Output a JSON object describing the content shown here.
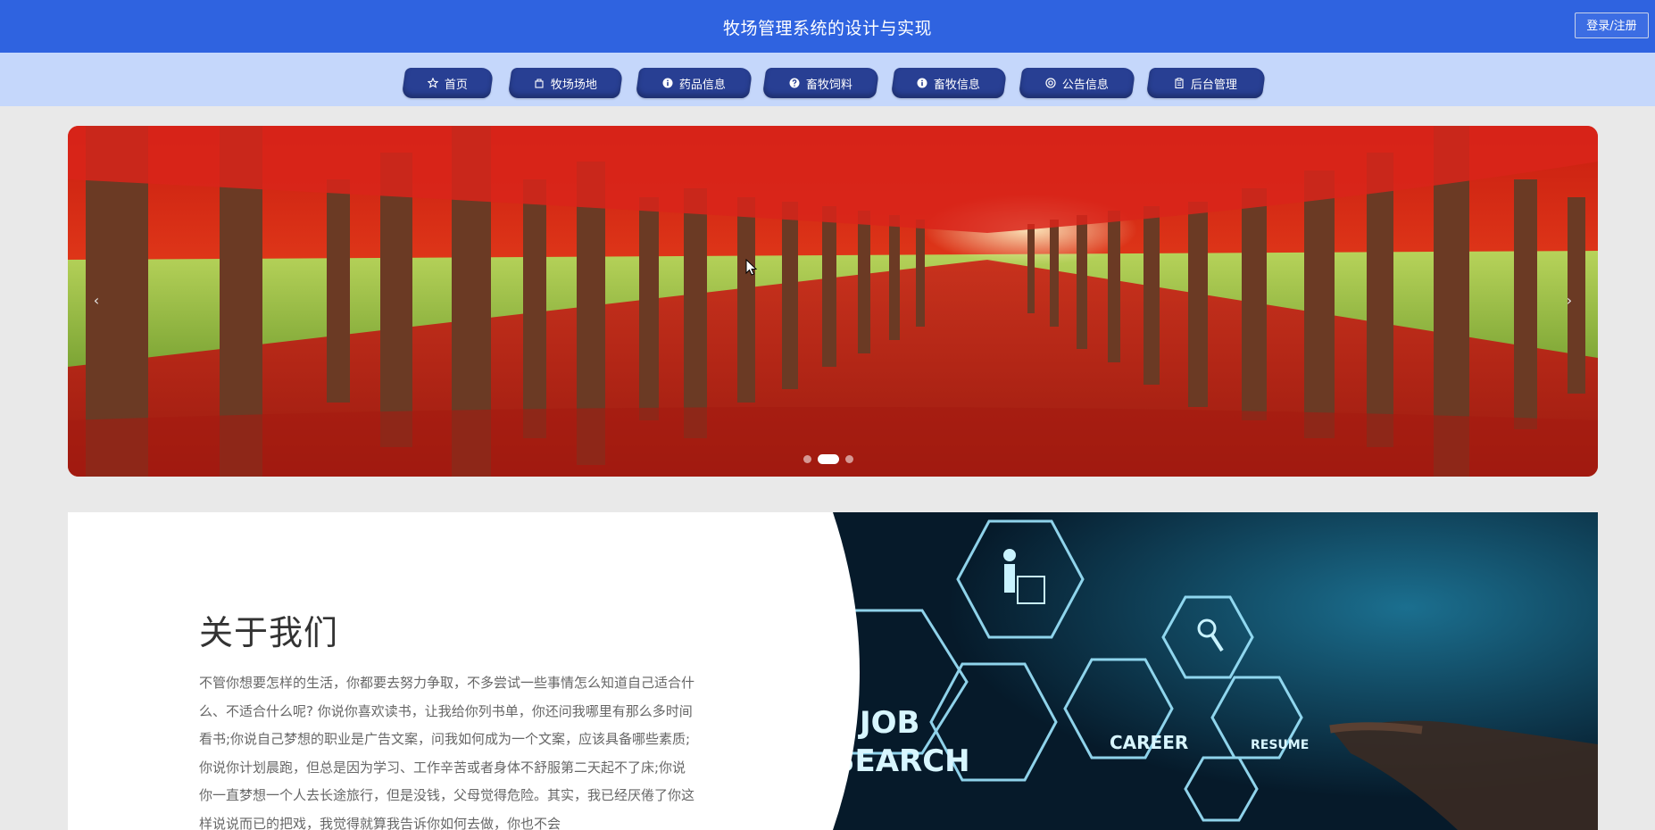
{
  "header": {
    "title": "牧场管理系统的设计与实现",
    "login_label": "登录/注册"
  },
  "nav": {
    "items": [
      {
        "label": "首页",
        "icon": "star-icon"
      },
      {
        "label": "牧场场地",
        "icon": "building-icon"
      },
      {
        "label": "药品信息",
        "icon": "info-icon"
      },
      {
        "label": "畜牧饲料",
        "icon": "question-icon"
      },
      {
        "label": "畜牧信息",
        "icon": "info-icon"
      },
      {
        "label": "公告信息",
        "icon": "circle-icon"
      },
      {
        "label": "后台管理",
        "icon": "clipboard-icon"
      }
    ]
  },
  "banner": {
    "prev_symbol": "‹",
    "next_symbol": "›",
    "slides": 3,
    "active_slide": 2
  },
  "about": {
    "title": "关于我们",
    "text": "不管你想要怎样的生活，你都要去努力争取，不多尝试一些事情怎么知道自己适合什么、不适合什么呢? 你说你喜欢读书，让我给你列书单，你还问我哪里有那么多时间看书;你说自己梦想的职业是广告文案，问我如何成为一个文案，应该具备哪些素质;你说你计划晨跑，但总是因为学习、工作辛苦或者身体不舒服第二天起不了床;你说你一直梦想一个人去长途旅行，但是没钱，父母觉得危险。其实，我已经厌倦了你这样说说而已的把戏，我觉得就算我告诉你如何去做，你也不会",
    "image_words": [
      "JOB",
      "SEARCH",
      "CAREER",
      "RESUME"
    ]
  },
  "colors": {
    "header_bg": "#2f63e0",
    "nav_bg": "#c5d7fb",
    "nav_item_bg": "#283f93",
    "page_bg": "#e9e9e9"
  }
}
